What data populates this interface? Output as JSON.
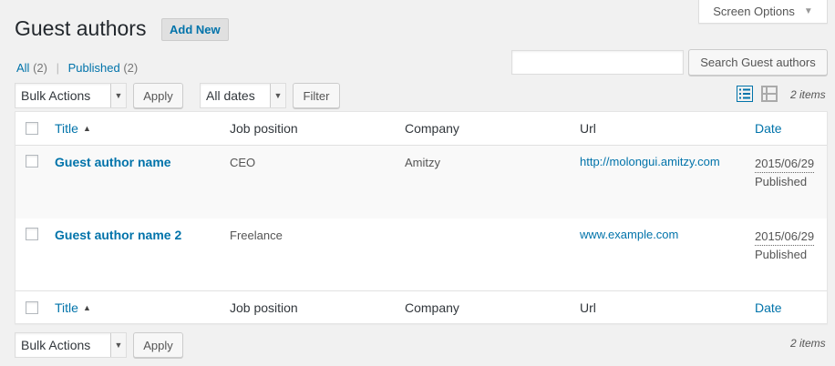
{
  "screen_options": {
    "label": "Screen Options",
    "arrow": "▼"
  },
  "header": {
    "title": "Guest authors",
    "add_new": "Add New"
  },
  "filters": {
    "all_label": "All",
    "all_count": "(2)",
    "separator": "|",
    "published_label": "Published",
    "published_count": "(2)"
  },
  "search": {
    "value": "",
    "button": "Search Guest authors"
  },
  "toolbar": {
    "bulk_actions": "Bulk Actions",
    "apply": "Apply",
    "dates": "All dates",
    "filter": "Filter",
    "items": "2 items"
  },
  "table": {
    "columns": {
      "title": "Title",
      "job": "Job position",
      "company": "Company",
      "url": "Url",
      "date": "Date"
    },
    "rows": [
      {
        "title": "Guest author name",
        "job": "CEO",
        "company": "Amitzy",
        "url": "http://molongui.amitzy.com",
        "date": "2015/06/29",
        "status": "Published"
      },
      {
        "title": "Guest author name 2",
        "job": "Freelance",
        "company": "",
        "url": "www.example.com",
        "date": "2015/06/29",
        "status": "Published"
      }
    ]
  },
  "colors": {
    "link": "#0073aa",
    "background": "#f1f1f1"
  },
  "icons": {
    "list_view": "list-view-icon",
    "excerpt_view": "excerpt-view-icon",
    "sort": "sort-up-icon",
    "caret": "chevron-down-icon"
  }
}
